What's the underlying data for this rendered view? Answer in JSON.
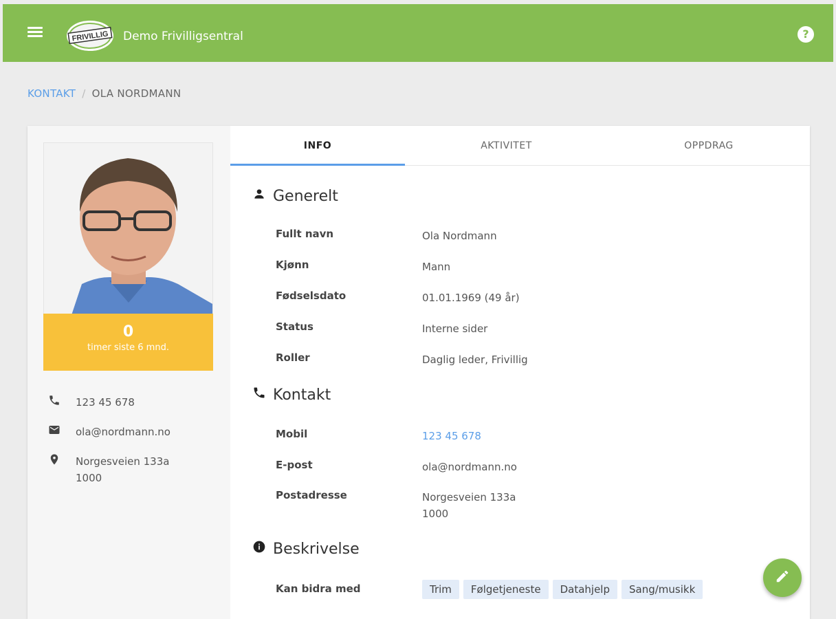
{
  "header": {
    "logo_text": "FRIVILLIG",
    "title": "Demo Frivilligsentral"
  },
  "breadcrumb": {
    "parent": "KONTAKT",
    "separator": "/",
    "current": "OLA NORDMANN"
  },
  "profile": {
    "hours_value": "0",
    "hours_label": "timer siste 6 mnd.",
    "phone": "123 45 678",
    "email": "ola@nordmann.no",
    "address_line1": "Norgesveien 133a",
    "address_line2": "1000"
  },
  "tabs": [
    {
      "label": "INFO",
      "active": true
    },
    {
      "label": "AKTIVITET",
      "active": false
    },
    {
      "label": "OPPDRAG",
      "active": false
    }
  ],
  "sections": {
    "general": {
      "title": "Generelt",
      "fields": [
        {
          "label": "Fullt navn",
          "value": "Ola Nordmann"
        },
        {
          "label": "Kjønn",
          "value": "Mann"
        },
        {
          "label": "Fødselsdato",
          "value": "01.01.1969 (49 år)"
        },
        {
          "label": "Status",
          "value": "Interne sider"
        },
        {
          "label": "Roller",
          "value": "Daglig leder, Frivillig"
        }
      ]
    },
    "contact": {
      "title": "Kontakt",
      "fields": [
        {
          "label": "Mobil",
          "value": "123 45 678"
        },
        {
          "label": "E-post",
          "value": "ola@nordmann.no"
        },
        {
          "label": "Postadresse",
          "value": "Norgesveien 133a",
          "value2": "1000"
        }
      ]
    },
    "description": {
      "title": "Beskrivelse",
      "field_label": "Kan bidra med",
      "chips": [
        "Trim",
        "Følgetjeneste",
        "Datahjelp",
        "Sang/musikk"
      ]
    }
  },
  "colors": {
    "header_green": "#86bd52",
    "hours_yellow": "#f8c13a",
    "link_blue": "#5b9ee8"
  },
  "icons": {
    "menu": "menu-icon",
    "help": "help-icon",
    "phone": "phone-icon",
    "email": "email-icon",
    "location": "location-icon",
    "person": "person-icon",
    "info": "info-icon",
    "edit": "edit-pencil-icon"
  }
}
